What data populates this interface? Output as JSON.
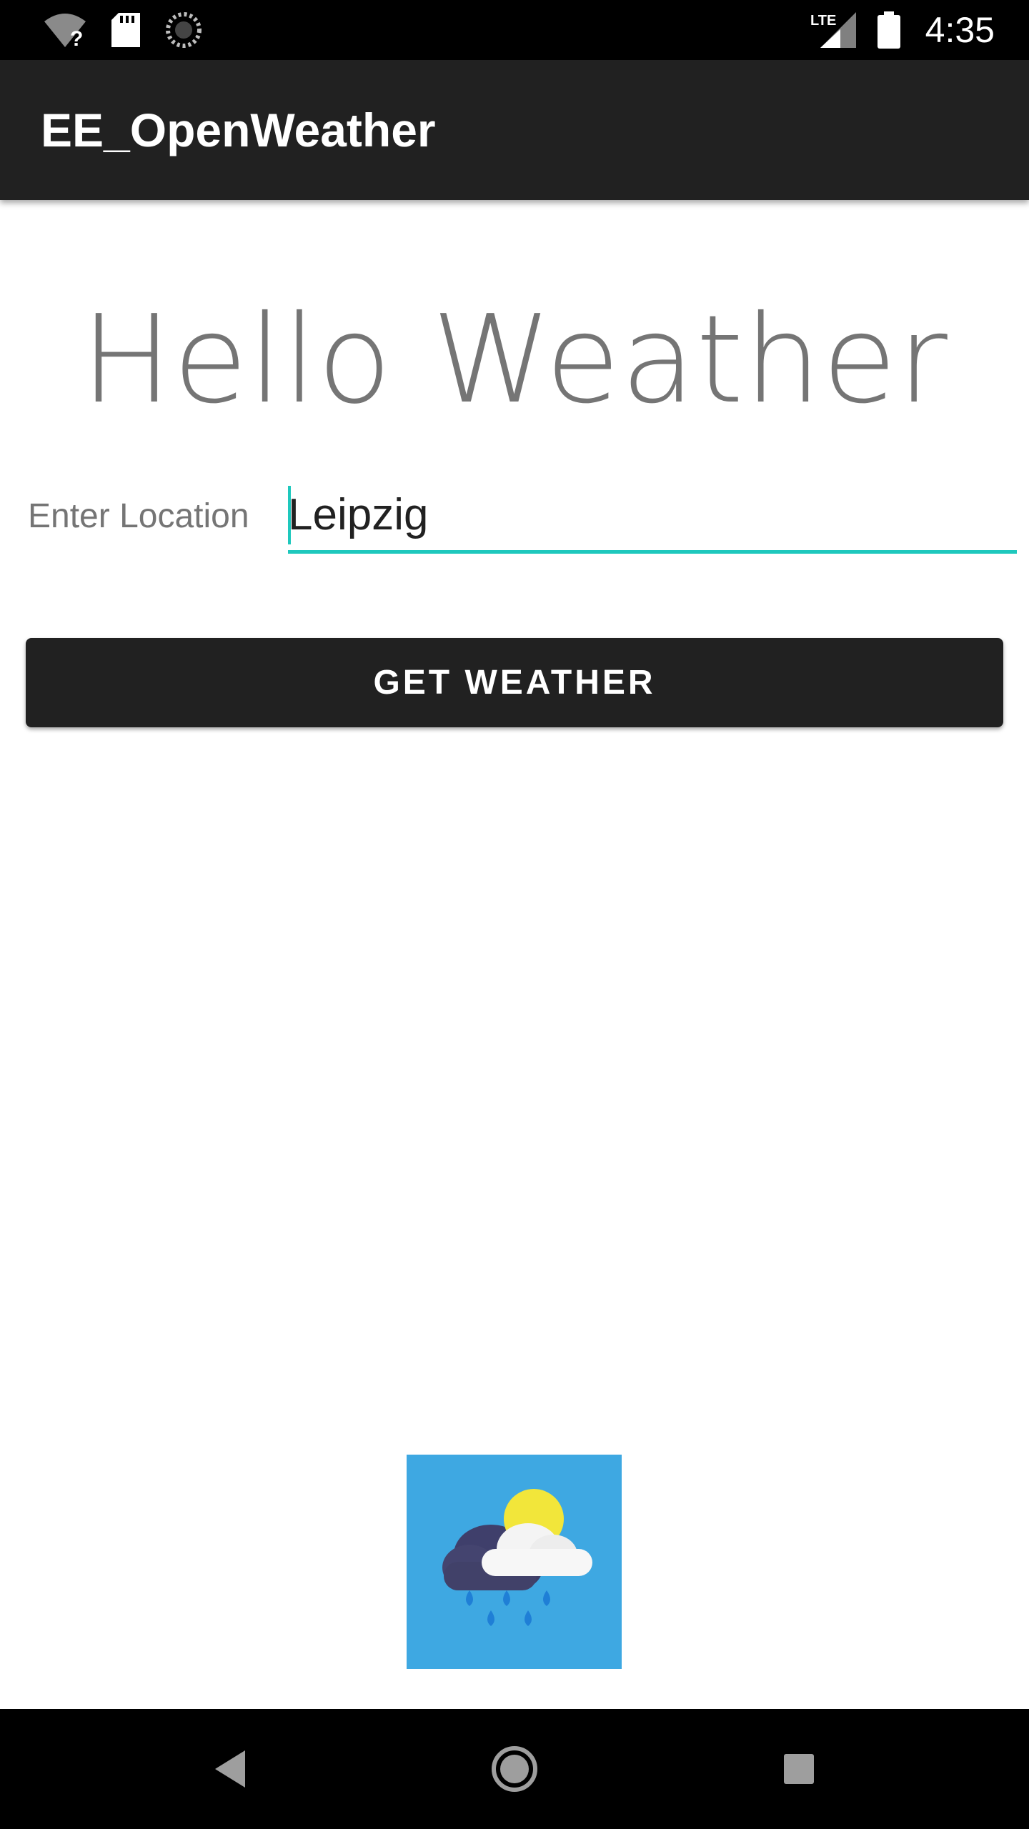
{
  "status_bar": {
    "time": "4:35",
    "icons": [
      "wifi-unknown-icon",
      "sd-card-icon",
      "sync-icon",
      "lte-signal-icon",
      "battery-icon"
    ],
    "network_label": "LTE"
  },
  "app_bar": {
    "title": "EE_OpenWeather"
  },
  "main": {
    "heading": "Hello Weather",
    "location_label": "Enter Location",
    "location_value": "Leipzig",
    "button_label": "GET WEATHER",
    "weather_icon": "rain-cloud-sun-icon"
  },
  "nav_bar": {
    "icons": [
      "back-icon",
      "home-icon",
      "recents-icon"
    ]
  },
  "colors": {
    "accent": "#1ec8bd",
    "app_bar": "#212121",
    "image_bg": "#3ea8e2"
  }
}
